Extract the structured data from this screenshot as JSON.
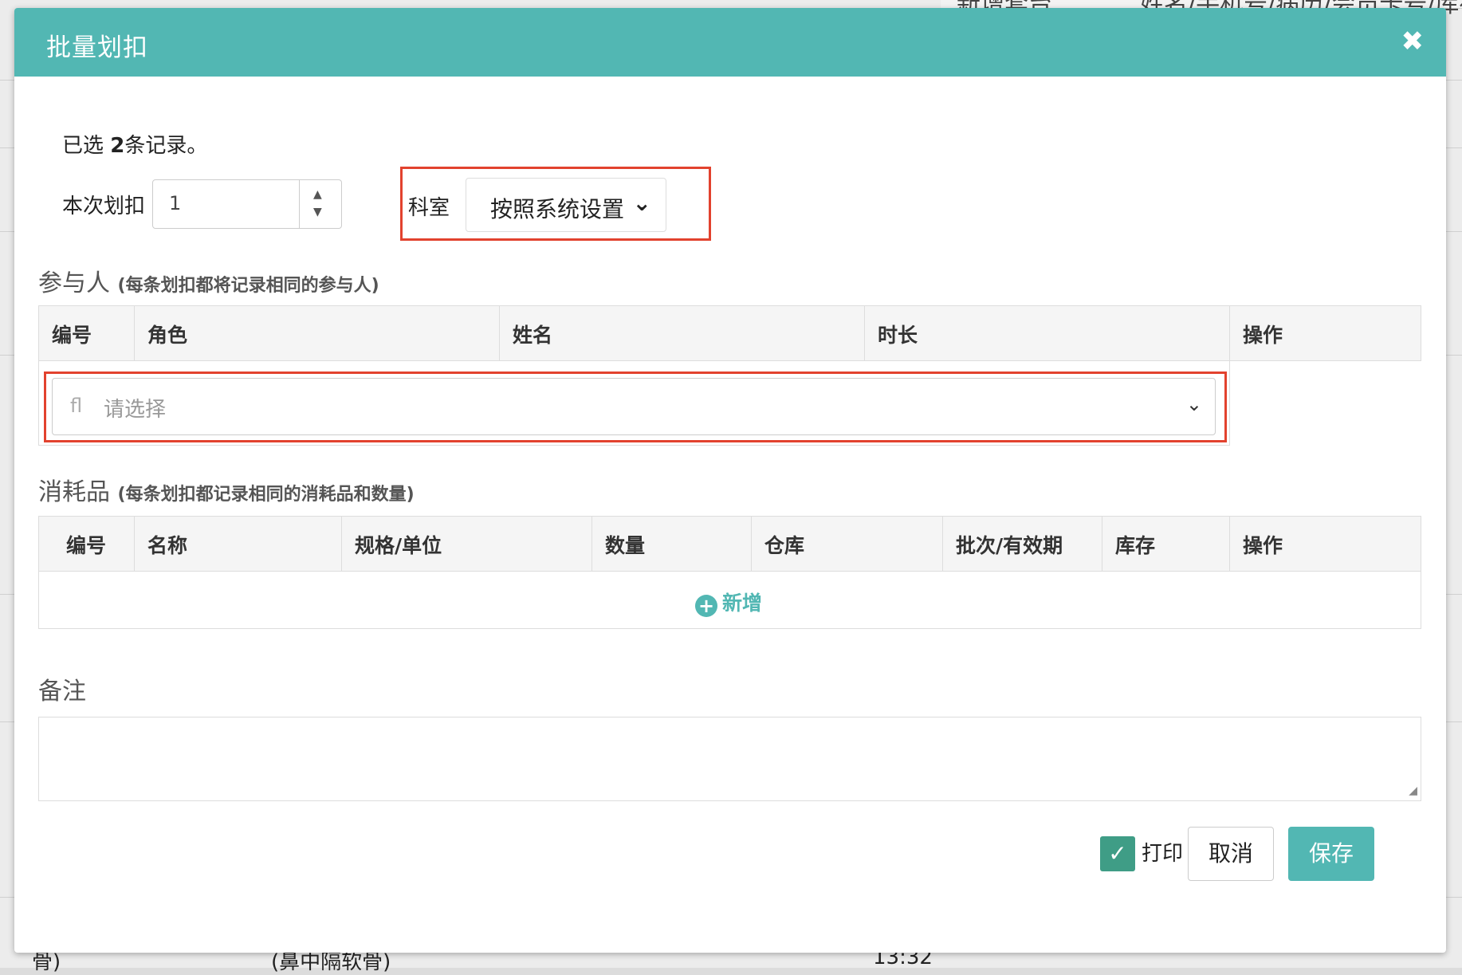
{
  "background": {
    "top_button": "新增套台",
    "top_text": "姓名/手机号/病历/会员卡号/库存",
    "row_text_1": "骨)",
    "row_text_2": "(鼻中隔软骨)",
    "row_text_3": "13:32"
  },
  "modal": {
    "title": "批量划扣",
    "close_icon": "✖",
    "selected_prefix": "已选 ",
    "selected_count": "2",
    "selected_suffix": "条记录。",
    "deduct_label": "本次划扣",
    "deduct_value": "1",
    "dept_label": "科室",
    "dept_value": "按照系统设置",
    "participants": {
      "title": "参与人",
      "subtitle": "(每条划扣都将记录相同的参与人)",
      "columns": [
        "编号",
        "角色",
        "姓名",
        "时长",
        "操作"
      ],
      "select_placeholder": "请选择",
      "select_icon": "fl"
    },
    "consumables": {
      "title": "消耗品",
      "subtitle": "(每条划扣都记录相同的消耗品和数量)",
      "columns": [
        "编号",
        "名称",
        "规格/单位",
        "数量",
        "仓库",
        "批次/有效期",
        "库存",
        "操作"
      ],
      "add_label": "新增"
    },
    "remarks_label": "备注",
    "print_label": "打印",
    "print_checked": true,
    "cancel_label": "取消",
    "save_label": "保存"
  },
  "colors": {
    "header": "#52b7b3",
    "highlight": "#e2422e",
    "check": "#3f9d86"
  }
}
